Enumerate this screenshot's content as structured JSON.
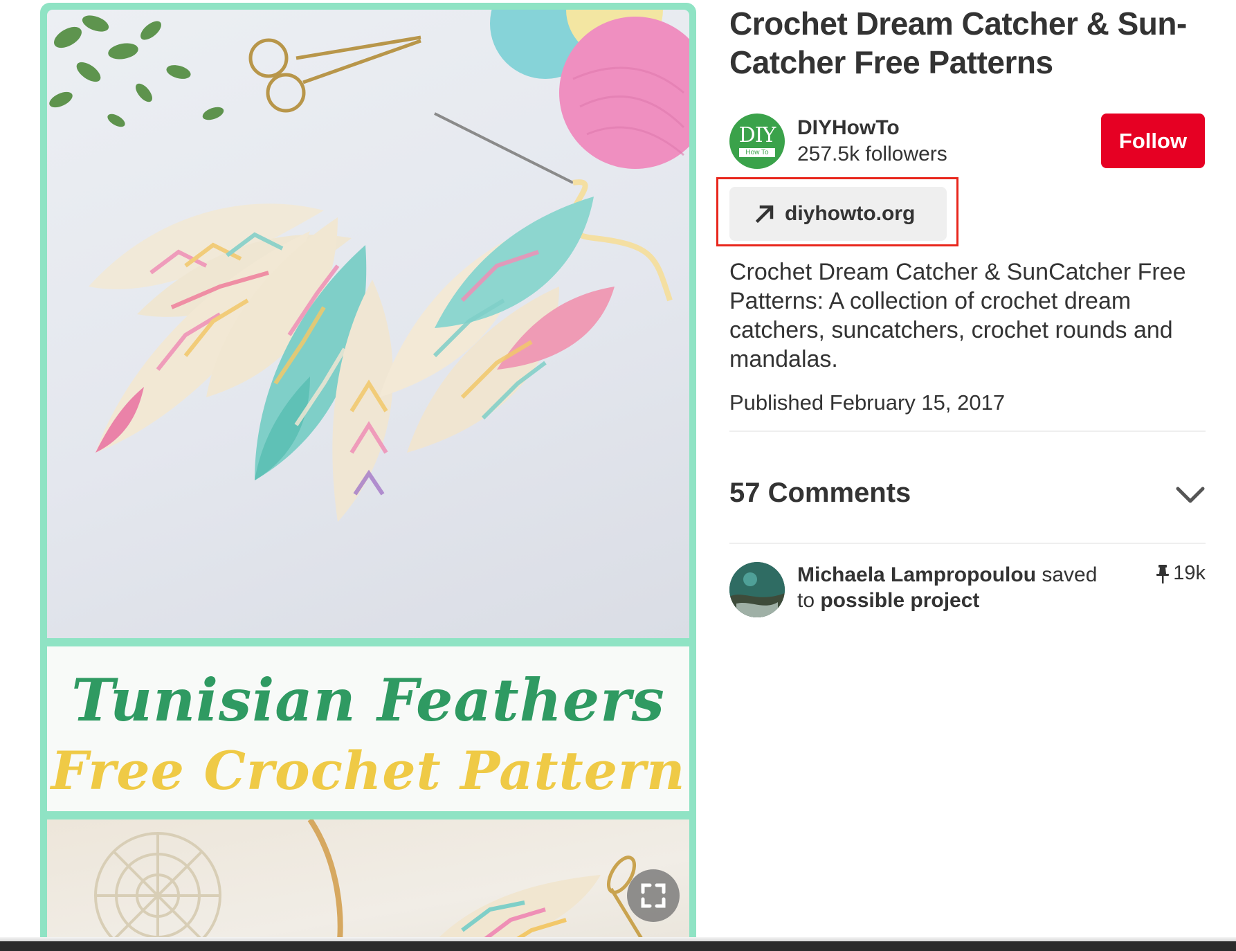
{
  "pin": {
    "image": {
      "headline": "Tunisian Feathers",
      "subheadline": "Free Crochet Pattern"
    },
    "title": "Crochet Dream Catcher & Sun-Catcher Free Patterns",
    "creator": {
      "avatar_text": "DIY",
      "avatar_subtext": "How To",
      "name": "DIYHowTo",
      "followers": "257.5k followers",
      "follow_label": "Follow"
    },
    "link": {
      "label": "diyhowto.org",
      "icon": "arrow-up-right-icon"
    },
    "description": "Crochet Dream Catcher & SunCatcher Free Patterns: A collection of crochet dream catchers, suncatchers, crochet rounds and mandalas.",
    "published": "Published February 15, 2017",
    "comments": {
      "title": "57 Comments",
      "icon": "chevron-down-icon"
    },
    "activity": {
      "user": "Michaela Lampropoulou",
      "action": " saved",
      "preposition": "to ",
      "board": "possible project",
      "save_count": "19k",
      "save_icon": "pin-icon"
    }
  },
  "colors": {
    "follow_button": "#e60023",
    "highlight_outline": "#e8261c",
    "image_border": "#8fe3c4",
    "headline_green": "#2f9a62",
    "headline_yellow": "#efca46"
  }
}
